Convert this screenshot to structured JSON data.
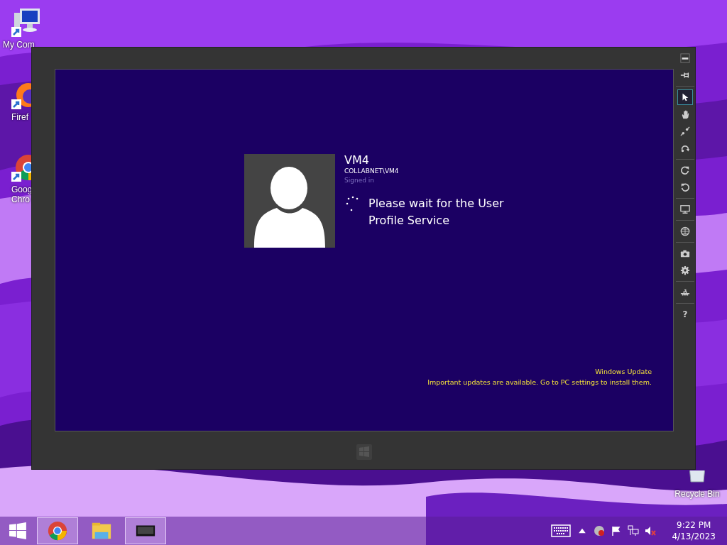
{
  "desktop_icons": [
    {
      "kind": "computer",
      "lines": [
        "My Com"
      ]
    },
    {
      "kind": "firefox",
      "lines": [
        "Firef"
      ]
    },
    {
      "kind": "chrome",
      "lines": [
        "Goog",
        "Chro"
      ]
    },
    {
      "kind": "recycle-bin",
      "lines": [
        "Recycle Bin"
      ]
    }
  ],
  "vm_window": {
    "toolbar": [
      {
        "kind": "minimize",
        "selected": false
      },
      {
        "kind": "pin",
        "selected": false
      },
      {
        "kind": "separator"
      },
      {
        "kind": "pointer",
        "selected": true
      },
      {
        "kind": "hand",
        "selected": false
      },
      {
        "kind": "pinch",
        "selected": false
      },
      {
        "kind": "swipe",
        "selected": false
      },
      {
        "kind": "separator"
      },
      {
        "kind": "rotate-right",
        "selected": false
      },
      {
        "kind": "rotate-left",
        "selected": false
      },
      {
        "kind": "separator"
      },
      {
        "kind": "monitor",
        "selected": false
      },
      {
        "kind": "separator"
      },
      {
        "kind": "globe",
        "selected": false
      },
      {
        "kind": "separator"
      },
      {
        "kind": "camera",
        "selected": false
      },
      {
        "kind": "gear",
        "selected": false
      },
      {
        "kind": "separator"
      },
      {
        "kind": "network",
        "selected": false
      },
      {
        "kind": "separator"
      },
      {
        "kind": "help",
        "glyph": "?",
        "selected": false
      }
    ],
    "login": {
      "user_name": "VM4",
      "account": "COLLABNET\\VM4",
      "status": "Signed in",
      "message_lines": [
        "Please wait for the User",
        "Profile Service"
      ]
    },
    "notification": {
      "title": "Windows Update",
      "text": "Important updates are available. Go to PC settings to install them."
    }
  },
  "taskbar": {
    "apps": [
      {
        "kind": "chrome",
        "selected": true
      },
      {
        "kind": "explorer",
        "selected": false
      },
      {
        "kind": "vm",
        "selected": true
      }
    ],
    "time": "9:22 PM",
    "date": "4/13/2023"
  }
}
